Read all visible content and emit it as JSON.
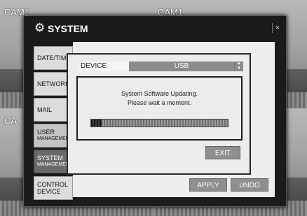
{
  "cameras": [
    {
      "label": "CAM1"
    },
    {
      "label": "CAM1"
    },
    {
      "label": "CA"
    },
    {
      "label": ""
    }
  ],
  "window": {
    "title": "SYSTEM",
    "close_symbol": "×",
    "title_icon": "gear-icon",
    "close_icon": "close-icon"
  },
  "tabs": [
    {
      "label": "DATE/TIM",
      "sub": ""
    },
    {
      "label": "NETWORI",
      "sub": ""
    },
    {
      "label": "MAIL",
      "sub": ""
    },
    {
      "label": "USER",
      "sub": "MANAGEMEN"
    },
    {
      "label": "SYSTEM",
      "sub": "MANAGEMEN"
    },
    {
      "label": "CONTROL",
      "sub": "DEVICE"
    }
  ],
  "dialog": {
    "device_label": "DEVICE",
    "device_value": "USB",
    "message_line1": "System Software Updating.",
    "message_line2": "Please wait a moment.",
    "progress": 0.08,
    "exit_label": "EXIT"
  },
  "buttons": {
    "apply_label": "APPLY",
    "undo_label": "UNDO"
  },
  "colors": {
    "window_bg": "#1b1b1b",
    "active_tab": "#6a6a6a",
    "button": "#8f8f8f"
  }
}
